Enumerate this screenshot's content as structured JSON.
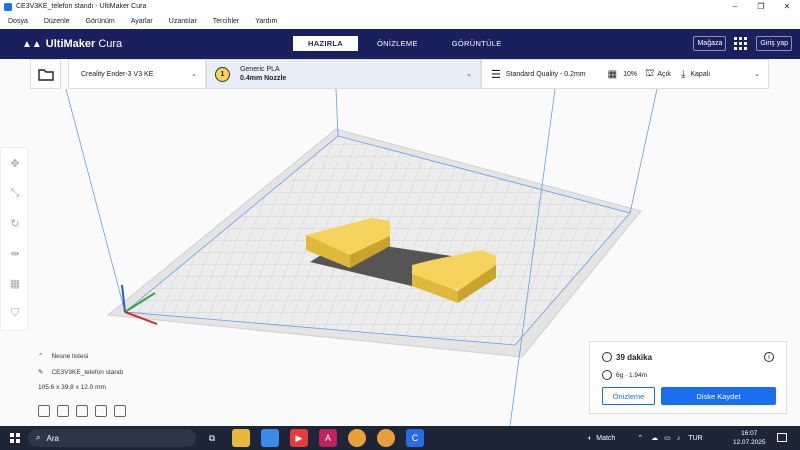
{
  "window": {
    "title": "CE3V3KE_telefon standı - UltiMaker Cura",
    "controls": [
      "–",
      "❐",
      "✕"
    ]
  },
  "menu": [
    "Dosya",
    "Düzenle",
    "Görünüm",
    "Ayarlar",
    "Uzantılar",
    "Tercihler",
    "Yardım"
  ],
  "header": {
    "brand": "UltiMaker",
    "brand_suffix": "Cura",
    "tabs": [
      "HAZIRLA",
      "ÖNİZLEME",
      "GÖRÜNTÜLE"
    ],
    "active_tab": "HAZIRLA",
    "marketplace": "Mağaza",
    "signin": "Giriş yap"
  },
  "toolbar": {
    "printer": "Creality Ender-3 V3 KE",
    "extruder_number": "1",
    "material": "Generic PLA",
    "nozzle": "0.4mm Nozzle",
    "quality": "Standard Quality - 0.2mm",
    "infill": "10%",
    "support": "Açık",
    "adhesion": "Kapalı"
  },
  "object_list": {
    "header": "Nesne listesi",
    "object_name": "CE3V3KE_telefon standı",
    "dimensions": "105.6 x 39.8 x 12.0 mm"
  },
  "print": {
    "time": "39 dakika",
    "material_usage": "6g · 1.94m",
    "preview_button": "Önizleme",
    "save_button": "Diske Kaydet"
  },
  "taskbar": {
    "search_placeholder": "Ara",
    "weather": "Match",
    "language": "TUR",
    "time": "16:07",
    "date": "12.07.2025"
  },
  "colors": {
    "header_bg": "#1a1f5e",
    "accent_blue": "#196ef0",
    "model_yellow": "#f5d35c",
    "taskbar_bg": "#1c2636"
  }
}
